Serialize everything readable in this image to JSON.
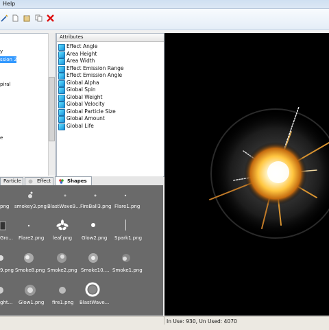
{
  "menu": {
    "help": "Help"
  },
  "tree": {
    "items": [
      {
        "label": "y"
      },
      {
        "label": "ssion 2",
        "selected": true
      },
      {
        "label": "piral"
      },
      {
        "label": "e"
      }
    ]
  },
  "attributes": {
    "header": "Attributes",
    "items": [
      "Effect Angle",
      "Area Height",
      "Area Width",
      "Effect Emission Range",
      "Effect Emission Angle",
      "Global Alpha",
      "Global Spin",
      "Global Weight",
      "Global Velocity",
      "Global Particle Size",
      "Global Amount",
      "Global Life"
    ]
  },
  "tabs": [
    {
      "label": "Particle"
    },
    {
      "label": "Effect"
    },
    {
      "label": "Shapes",
      "active": true
    }
  ],
  "shapes": {
    "rows": [
      [
        "png",
        "smokey3.png",
        "BlastWave9...",
        "FireBall3.png",
        "Flare1.png"
      ],
      [
        "Gro...",
        "Flare2.png",
        "leaf.png",
        "Glow2.png",
        "Spark1.png"
      ],
      [
        "9.png",
        "Smoke8.png",
        "Smoke2.png",
        "Smoke10....",
        "Smoke1.png"
      ],
      [
        "ght...",
        "Glow1.png",
        "fire1.png",
        "BlastWave..."
      ]
    ]
  },
  "status": {
    "text": "In Use: 930, Un Used: 4070"
  },
  "colors": {
    "selection": "#3399ff",
    "shapes_bg": "#6a6a6a",
    "preview_bg": "#000000"
  }
}
